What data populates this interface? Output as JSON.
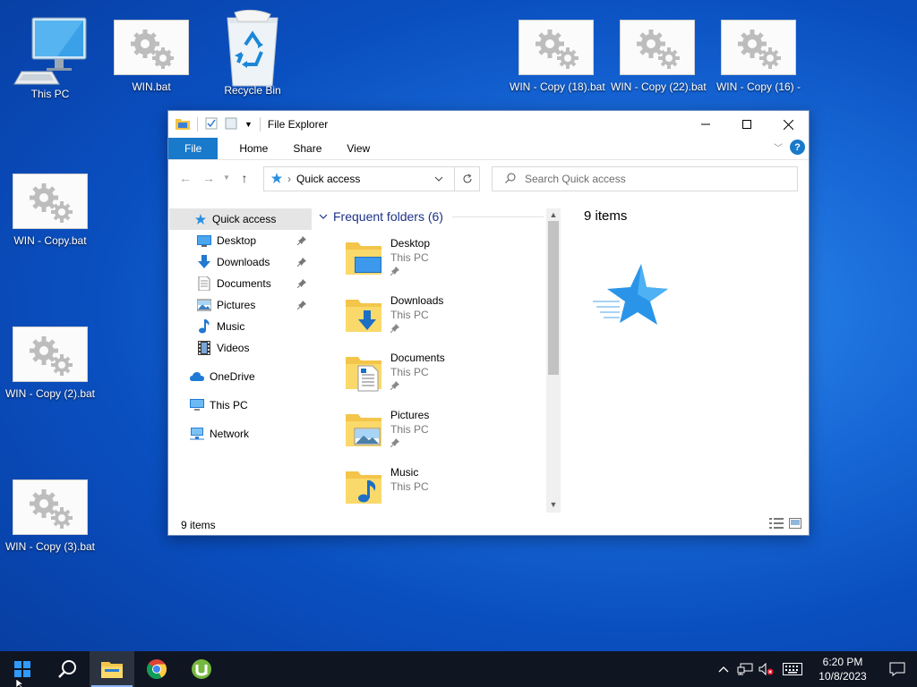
{
  "desktop": {
    "icons": [
      {
        "label": "This PC"
      },
      {
        "label": "WIN.bat"
      },
      {
        "label": "Recycle Bin"
      },
      {
        "label": "WIN - Copy (18).bat"
      },
      {
        "label": "WIN - Copy (22).bat"
      },
      {
        "label": "WIN - Copy (16) -"
      },
      {
        "label": "WIN - Copy.bat"
      },
      {
        "label": "WIN - Copy (2).bat"
      },
      {
        "label": "WIN - Copy (3).bat"
      }
    ]
  },
  "explorer": {
    "title": "File Explorer",
    "ribbon_tabs": [
      "File",
      "Home",
      "Share",
      "View"
    ],
    "address": {
      "location": "Quick access"
    },
    "search": {
      "placeholder": "Search Quick access"
    },
    "nav_pane": {
      "items": [
        {
          "label": "Quick access",
          "icon": "star-icon",
          "pinned": false
        },
        {
          "label": "Desktop",
          "icon": "desktop-icon",
          "pinned": true
        },
        {
          "label": "Downloads",
          "icon": "download-icon",
          "pinned": true
        },
        {
          "label": "Documents",
          "icon": "document-icon",
          "pinned": true
        },
        {
          "label": "Pictures",
          "icon": "picture-icon",
          "pinned": true
        },
        {
          "label": "Music",
          "icon": "music-icon",
          "pinned": false
        },
        {
          "label": "Videos",
          "icon": "video-icon",
          "pinned": false
        },
        {
          "label": "OneDrive",
          "icon": "cloud-icon",
          "pinned": false
        },
        {
          "label": "This PC",
          "icon": "computer-icon",
          "pinned": false
        },
        {
          "label": "Network",
          "icon": "network-icon",
          "pinned": false
        }
      ]
    },
    "content": {
      "group_header": "Frequent folders (6)",
      "folders": [
        {
          "name": "Desktop",
          "location": "This PC",
          "pinned": true
        },
        {
          "name": "Downloads",
          "location": "This PC",
          "pinned": true
        },
        {
          "name": "Documents",
          "location": "This PC",
          "pinned": true
        },
        {
          "name": "Pictures",
          "location": "This PC",
          "pinned": true
        },
        {
          "name": "Music",
          "location": "This PC",
          "pinned": false
        }
      ]
    },
    "preview": {
      "count_text": "9 items"
    },
    "status": {
      "text": "9 items"
    }
  },
  "taskbar": {
    "clock": {
      "time": "6:20 PM",
      "date": "10/8/2023"
    }
  },
  "colors": {
    "accent": "#1979ca",
    "taskbar": "#101522",
    "group_header": "#1e3287"
  }
}
